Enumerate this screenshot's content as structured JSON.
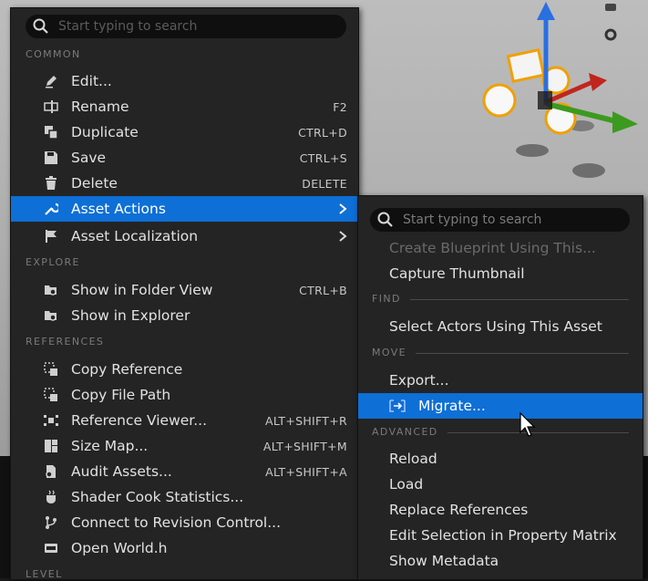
{
  "search": {
    "placeholder": "Start typing to search"
  },
  "sections": {
    "common": "COMMON",
    "explore": "EXPLORE",
    "references": "REFERENCES",
    "level": "LEVEL"
  },
  "menu": {
    "common": [
      {
        "label": "Edit...",
        "shortcut": "",
        "icon": "pencil-icon"
      },
      {
        "label": "Rename",
        "shortcut": "F2",
        "icon": "rename-icon"
      },
      {
        "label": "Duplicate",
        "shortcut": "CTRL+D",
        "icon": "duplicate-icon"
      },
      {
        "label": "Save",
        "shortcut": "CTRL+S",
        "icon": "save-icon"
      },
      {
        "label": "Delete",
        "shortcut": "DELETE",
        "icon": "trash-icon"
      },
      {
        "label": "Asset Actions",
        "shortcut": "",
        "icon": "wrench-icon",
        "active": true,
        "submenu": true
      },
      {
        "label": "Asset Localization",
        "shortcut": "",
        "icon": "flag-icon",
        "submenu": true
      }
    ],
    "explore": [
      {
        "label": "Show in Folder View",
        "shortcut": "CTRL+B",
        "icon": "folder-search-icon"
      },
      {
        "label": "Show in Explorer",
        "shortcut": "",
        "icon": "folder-search-icon"
      }
    ],
    "references": [
      {
        "label": "Copy Reference",
        "shortcut": "",
        "icon": "copy-reference-icon"
      },
      {
        "label": "Copy File Path",
        "shortcut": "",
        "icon": "copy-path-icon"
      },
      {
        "label": "Reference Viewer...",
        "shortcut": "ALT+SHIFT+R",
        "icon": "reference-viewer-icon"
      },
      {
        "label": "Size Map...",
        "shortcut": "ALT+SHIFT+M",
        "icon": "size-map-icon"
      },
      {
        "label": "Audit Assets...",
        "shortcut": "ALT+SHIFT+A",
        "icon": "audit-icon"
      },
      {
        "label": "Shader Cook Statistics...",
        "shortcut": "",
        "icon": "shader-icon"
      },
      {
        "label": "Connect to Revision Control...",
        "shortcut": "",
        "icon": "revision-control-icon"
      },
      {
        "label": "Open World.h",
        "shortcut": "",
        "icon": "cpp-file-icon"
      }
    ]
  },
  "submenu": {
    "search_placeholder": "Start typing to search",
    "top": [
      {
        "label": "Create Blueprint Using This...",
        "disabled": true
      },
      {
        "label": "Capture Thumbnail"
      }
    ],
    "find_header": "FIND",
    "find": [
      {
        "label": "Select Actors Using This Asset"
      }
    ],
    "move_header": "MOVE",
    "move": [
      {
        "label": "Export..."
      },
      {
        "label": "Migrate...",
        "active": true,
        "icon": "migrate-icon"
      }
    ],
    "advanced_header": "ADVANCED",
    "advanced": [
      {
        "label": "Reload"
      },
      {
        "label": "Load"
      },
      {
        "label": "Replace References"
      },
      {
        "label": "Edit Selection in Property Matrix"
      },
      {
        "label": "Show Metadata"
      }
    ]
  },
  "colors": {
    "menu_bg": "#242424",
    "highlight": "#0e6fd6",
    "section_text": "#7a7a7a",
    "text": "#e2e2e2",
    "disabled_text": "#6a6a6a"
  }
}
